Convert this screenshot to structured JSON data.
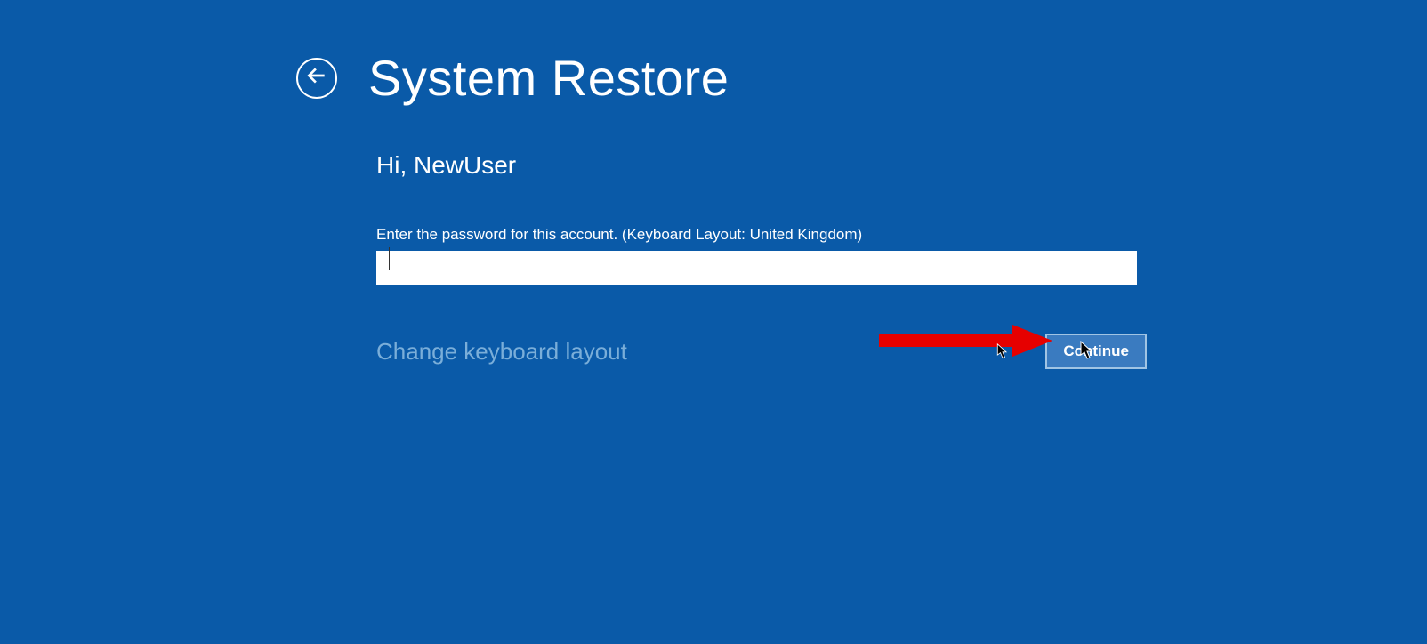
{
  "header": {
    "title": "System Restore"
  },
  "content": {
    "greeting": "Hi, NewUser",
    "password_label": "Enter the password for this account. (Keyboard Layout: United Kingdom)",
    "password_value": ""
  },
  "actions": {
    "change_keyboard_label": "Change keyboard layout",
    "continue_label": "Continue"
  },
  "icons": {
    "back": "back-arrow-icon"
  },
  "colors": {
    "background": "#0a5aa8",
    "text": "#ffffff",
    "link": "#7aaed9",
    "button_bg": "#3a7bc0",
    "button_border": "#a0c4e4",
    "annotation": "#e60000"
  }
}
